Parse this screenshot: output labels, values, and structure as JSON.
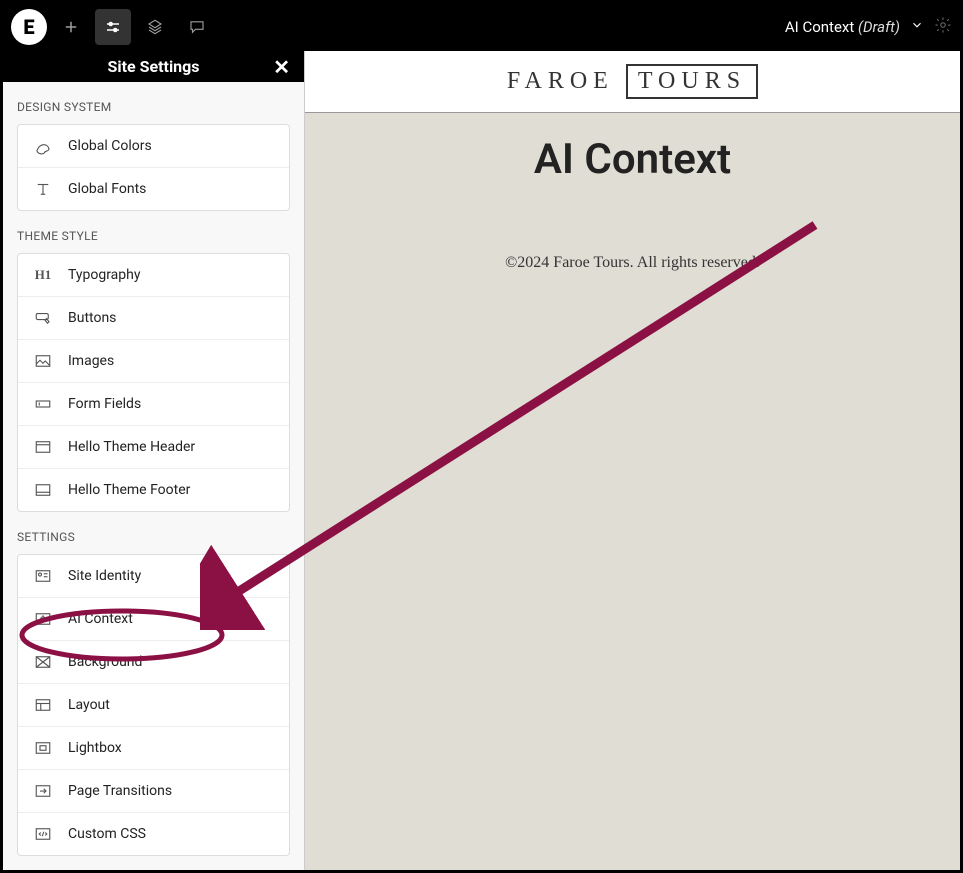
{
  "topbar": {
    "page_name": "AI Context",
    "page_status": "(Draft)"
  },
  "sidebar": {
    "title": "Site Settings",
    "sections": {
      "design_system": {
        "label": "DESIGN SYSTEM"
      },
      "theme_style": {
        "label": "THEME STYLE"
      },
      "settings": {
        "label": "SETTINGS"
      }
    },
    "design_items": [
      {
        "label": "Global Colors"
      },
      {
        "label": "Global Fonts"
      }
    ],
    "theme_items": [
      {
        "label": "Typography"
      },
      {
        "label": "Buttons"
      },
      {
        "label": "Images"
      },
      {
        "label": "Form Fields"
      },
      {
        "label": "Hello Theme Header"
      },
      {
        "label": "Hello Theme Footer"
      }
    ],
    "settings_items": [
      {
        "label": "Site Identity"
      },
      {
        "label": "AI Context"
      },
      {
        "label": "Background"
      },
      {
        "label": "Layout"
      },
      {
        "label": "Lightbox"
      },
      {
        "label": "Page Transitions"
      },
      {
        "label": "Custom CSS"
      }
    ]
  },
  "canvas": {
    "brand_faroe": "FAROE",
    "brand_tours": "TOURS",
    "page_heading": "AI Context",
    "footer": "©2024 Faroe Tours. All rights reserved."
  },
  "annotation": {
    "color": "#8b1144"
  }
}
